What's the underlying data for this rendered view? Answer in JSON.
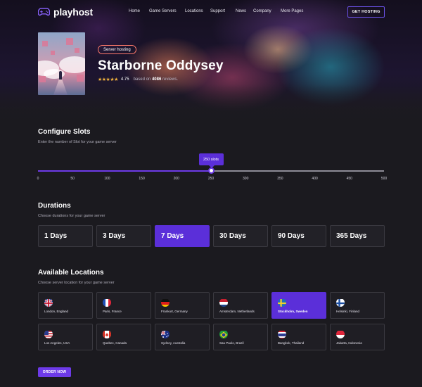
{
  "brand": {
    "name": "playhost",
    "accent": "#6d3ae8"
  },
  "nav": {
    "links": [
      "Home",
      "Game Servers",
      "Locations",
      "Support",
      "News",
      "Company",
      "More Pages"
    ],
    "cta": "GET HOSTING"
  },
  "hero": {
    "tag": "Server hosting",
    "title": "Starborne Oddysey",
    "rating_value": "4.75",
    "rating_prefix": "based on",
    "rating_count": "4086",
    "rating_suffix": "reviews.",
    "stars": 4.75
  },
  "slots": {
    "title": "Configure Slots",
    "subtitle": "Enter the number of Slot for your game server",
    "value_label": "250 slots",
    "value": 250,
    "min": 0,
    "max": 500,
    "ticks": [
      "0",
      "50",
      "100",
      "150",
      "200",
      "250",
      "300",
      "350",
      "400",
      "450",
      "500"
    ]
  },
  "durations": {
    "title": "Durations",
    "subtitle": "Choose durations for your game server",
    "options": [
      "1 Days",
      "3 Days",
      "7 Days",
      "30 Days",
      "90 Days",
      "365 Days"
    ],
    "selected": "7 Days"
  },
  "locations": {
    "title": "Available Locations",
    "subtitle": "Choose server location for your game server",
    "items": [
      {
        "label": "London, England",
        "flag": "uk-flag-icon"
      },
      {
        "label": "Paris, France",
        "flag": "france-flag-icon"
      },
      {
        "label": "Frankurt, Germany",
        "flag": "germany-flag-icon"
      },
      {
        "label": "Amsterdam, Netherlands",
        "flag": "netherlands-flag-icon"
      },
      {
        "label": "Stockholm, Sweden",
        "flag": "sweden-flag-icon"
      },
      {
        "label": "Helsinki, Finland",
        "flag": "finland-flag-icon"
      },
      {
        "label": "Los Angeles, USA",
        "flag": "usa-flag-icon"
      },
      {
        "label": "Quebec, Canada",
        "flag": "canada-flag-icon"
      },
      {
        "label": "Sydney, Australia",
        "flag": "australia-flag-icon"
      },
      {
        "label": "Sau Paulo, Brazil",
        "flag": "brazil-flag-icon"
      },
      {
        "label": "Bangkok, Thailand",
        "flag": "thailand-flag-icon"
      },
      {
        "label": "Jakarta, Indonesia",
        "flag": "indonesia-flag-icon"
      }
    ],
    "selected": "Stockholm, Sweden"
  },
  "order_button": "ORDER NOW"
}
